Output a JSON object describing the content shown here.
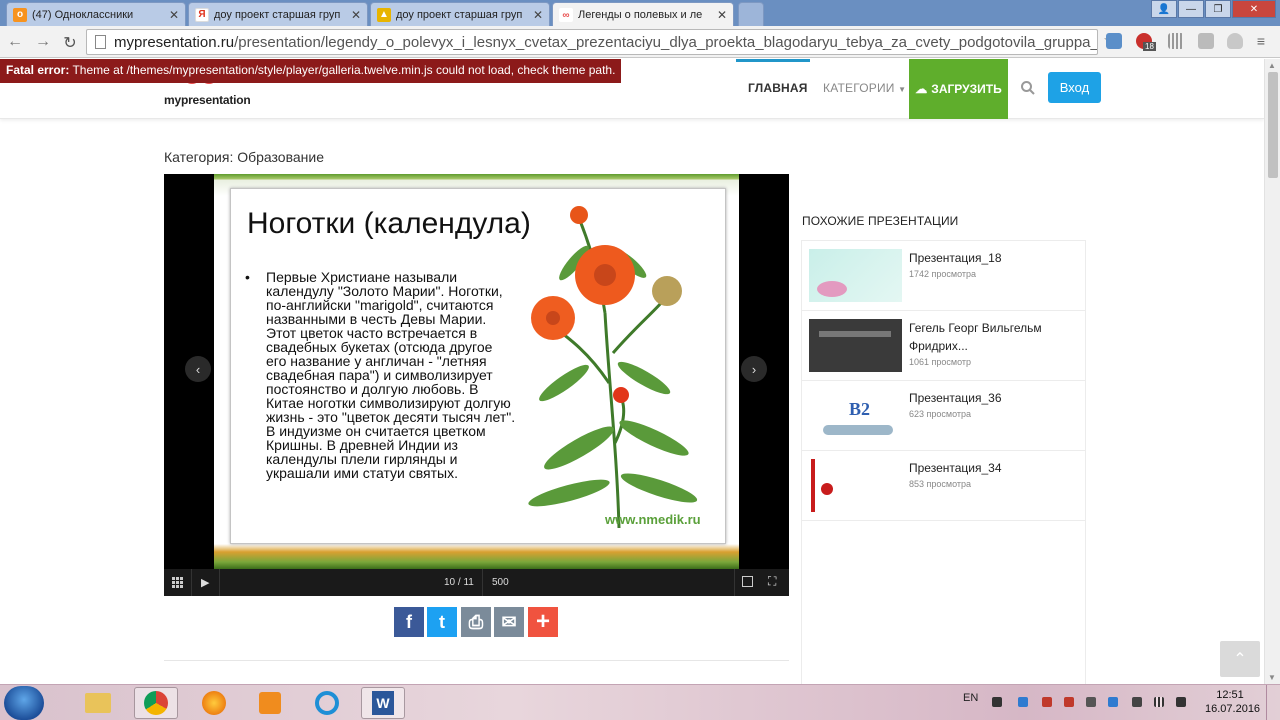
{
  "browser": {
    "tabs": [
      {
        "title": "(47) Одноклассники",
        "fav": "ok-icon",
        "color": "#f7931e"
      },
      {
        "title": "доу проект старшая груп",
        "fav": "yandex-icon",
        "color": "#e0321c"
      },
      {
        "title": "доу проект старшая груп",
        "fav": "folder-icon",
        "color": "#e8b400"
      },
      {
        "title": "Легенды о полевых и ле",
        "fav": "mypresentation-icon",
        "color": "#e94f4f"
      }
    ],
    "url_host": "mypresentation.ru",
    "url_path": "/presentation/legendy_o_polevyx_i_lesnyx_cvetax_prezentaciyu_dlya_proekta_blagodaryu_tebya_za_cvety_podgotovila_gruppa_i:",
    "ext_badge": "18"
  },
  "error": {
    "label": "Fatal error:",
    "message": " Theme at /themes/mypresentation/style/player/galleria.twelve.min.js could not load, check theme path."
  },
  "header": {
    "logo_text": "mypresentation",
    "nav_home": "ГЛАВНАЯ",
    "nav_categories": "КАТЕГОРИИ",
    "upload_label": "ЗАГРУЗИТЬ",
    "login_label": "Вход",
    "accent": "#1ea2e6",
    "upload_color": "#5fae2c"
  },
  "category_line": "Категория: Образование",
  "slide": {
    "title": "Ноготки (календула)",
    "bullet": "•",
    "body": "Первые Христиане называли календулу \"Золото Марии\". Ноготки, по-английски \"marigold\", считаются названными в честь Девы Марии. Этот цветок часто встречается в свадебных букетах (отсюда другое его название у англичан - \"летняя свадебная пара\") и символизирует постоянство и долгую любовь. В Китае ноготки символизируют долгую жизнь - это \"цветок десяти тысяч лет\". В индуизме он считается цветком Кришны. В древней Индии из календулы плели гирлянды и украшали ими статуи святых.",
    "credit": "www.nmedik.ru"
  },
  "player": {
    "counter": "10 / 11",
    "number": "500"
  },
  "share": [
    {
      "name": "facebook",
      "glyph": "f",
      "color": "#3b5998"
    },
    {
      "name": "twitter",
      "glyph": "t",
      "color": "#1da1f2"
    },
    {
      "name": "print",
      "glyph": "⎙",
      "color": "#7b8b9a"
    },
    {
      "name": "email",
      "glyph": "✉",
      "color": "#7b8b9a"
    },
    {
      "name": "more",
      "glyph": "+",
      "color": "#f0533f"
    }
  ],
  "related": {
    "heading": "ПОХОЖИЕ ПРЕЗЕНТАЦИИ",
    "items": [
      {
        "title": "Презентация_18",
        "views": "1742 просмотра"
      },
      {
        "title": "Гегель Георг Вильгельм Фридрих...",
        "views": "1061 просмотр"
      },
      {
        "title": "Презентация_36",
        "views": "623 просмотра"
      },
      {
        "title": "Презентация_34",
        "views": "853 просмотра"
      }
    ]
  },
  "taskbar": {
    "lang": "EN",
    "time": "12:51",
    "date": "16.07.2016"
  }
}
